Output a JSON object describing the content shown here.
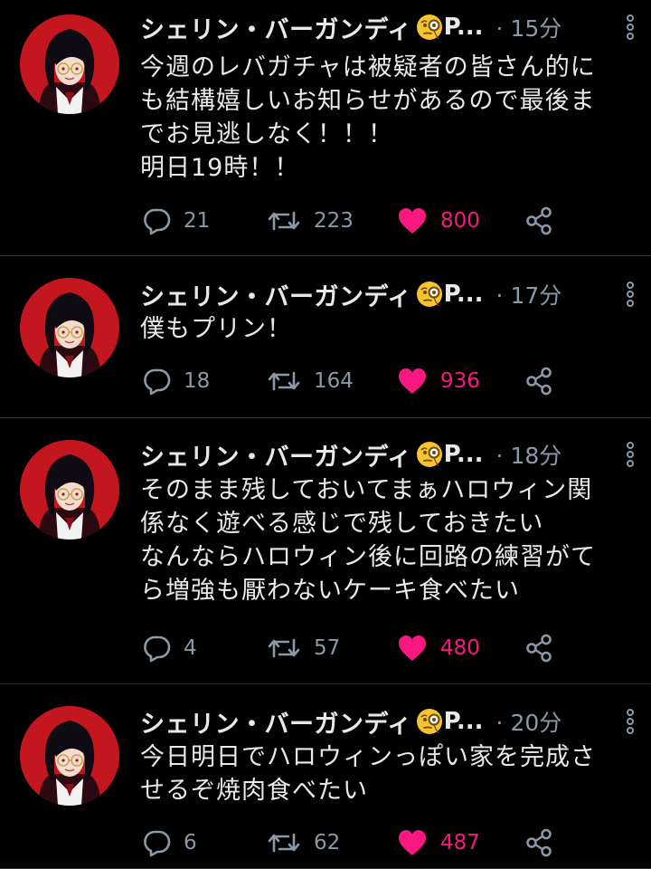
{
  "colors": {
    "background": "#000000",
    "text": "#e7e9ea",
    "secondary": "#8b98a5",
    "like": "#f91880",
    "divider": "#2f3336"
  },
  "tweets": [
    {
      "name": "シェリン・バーガンディ",
      "emoji": "face-with-monocle-emoji",
      "handle": "P...",
      "time": "· 15分",
      "lines": [
        "今週のレバガチャは被疑者の皆さん的に",
        "も結構嬉しいお知らせがあるので最後ま",
        "でお見逃しなく！！！",
        "明日19時！！"
      ],
      "replies": "21",
      "retweets": "223",
      "likes": "800"
    },
    {
      "name": "シェリン・バーガンディ",
      "emoji": "face-with-monocle-emoji",
      "handle": "P...",
      "time": "· 17分",
      "lines": [
        "僕もプリン！"
      ],
      "replies": "18",
      "retweets": "164",
      "likes": "936"
    },
    {
      "name": "シェリン・バーガンディ",
      "emoji": "face-with-monocle-emoji",
      "handle": "P...",
      "time": "· 18分",
      "lines": [
        "そのまま残しておいてまぁハロウィン関",
        "係なく遊べる感じで残しておきたい",
        "なんならハロウィン後に回路の練習がて",
        "ら増強も厭わないケーキ食べたい"
      ],
      "replies": "4",
      "retweets": "57",
      "likes": "480"
    },
    {
      "name": "シェリン・バーガンディ",
      "emoji": "face-with-monocle-emoji",
      "handle": "P...",
      "time": "· 20分",
      "lines": [
        "今日明日でハロウィンっぽい家を完成さ",
        "せるぞ焼肉食べたい"
      ],
      "replies": "6",
      "retweets": "62",
      "likes": "487"
    }
  ]
}
